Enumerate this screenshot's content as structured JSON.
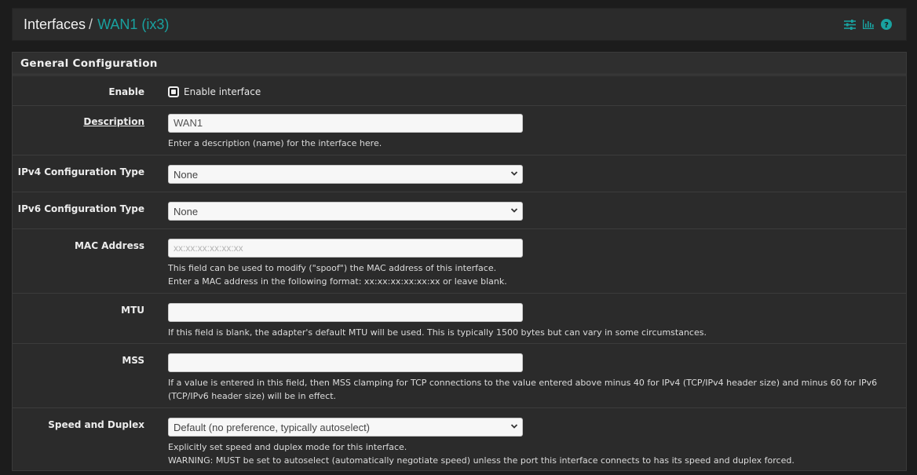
{
  "breadcrumb": {
    "root": "Interfaces",
    "separator": "/",
    "current": "WAN1 (ix3)"
  },
  "header_icons": [
    "sliders-icon",
    "bar-chart-icon",
    "help-icon"
  ],
  "colors": {
    "accent": "#19a2a0",
    "background": "#1c1c1c",
    "panel": "#2b2b2b"
  },
  "panel": {
    "title": "General Configuration"
  },
  "fields": {
    "enable": {
      "label": "Enable",
      "checkbox_label": "Enable interface",
      "checked": true
    },
    "description": {
      "label": "Description",
      "value": "WAN1",
      "help": "Enter a description (name) for the interface here."
    },
    "ipv4": {
      "label": "IPv4 Configuration Type",
      "value": "None"
    },
    "ipv6": {
      "label": "IPv6 Configuration Type",
      "value": "None"
    },
    "mac": {
      "label": "MAC Address",
      "placeholder": "xx:xx:xx:xx:xx:xx",
      "help1": "This field can be used to modify (\"spoof\") the MAC address of this interface.",
      "help2": "Enter a MAC address in the following format: xx:xx:xx:xx:xx:xx or leave blank."
    },
    "mtu": {
      "label": "MTU",
      "value": "",
      "help": "If this field is blank, the adapter's default MTU will be used. This is typically 1500 bytes but can vary in some circumstances."
    },
    "mss": {
      "label": "MSS",
      "value": "",
      "help": "If a value is entered in this field, then MSS clamping for TCP connections to the value entered above minus 40 for IPv4 (TCP/IPv4 header size) and minus 60 for IPv6 (TCP/IPv6 header size) will be in effect."
    },
    "speed": {
      "label": "Speed and Duplex",
      "value": "Default (no preference, typically autoselect)",
      "help1": "Explicitly set speed and duplex mode for this interface.",
      "help2": "WARNING: MUST be set to autoselect (automatically negotiate speed) unless the port this interface connects to has its speed and duplex forced."
    }
  }
}
